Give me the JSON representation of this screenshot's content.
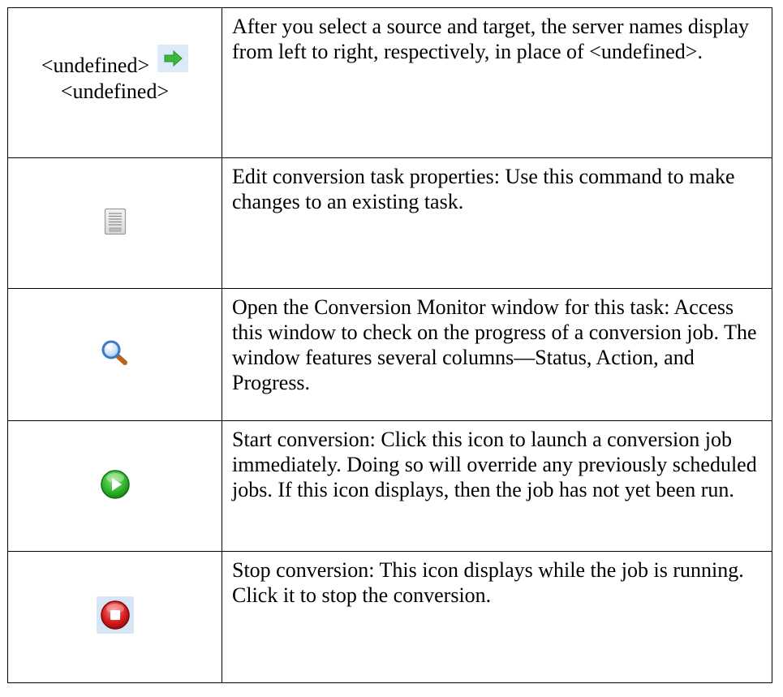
{
  "rows": [
    {
      "icon": "right-arrow-icon",
      "source_label": "<undefined>",
      "target_label": "<undefined>",
      "description": "After you select a source and target, the server names display from left to right, respectively, in place of <undefined>."
    },
    {
      "icon": "document-properties-icon",
      "description": "Edit conversion task properties:  Use this command to make changes to an existing task."
    },
    {
      "icon": "magnifier-icon",
      "description": "Open the Conversion Monitor window for this task: Access this window to check on the progress of a conversion job. The window features several columns—Status, Action, and Progress."
    },
    {
      "icon": "play-icon",
      "description": "Start conversion:  Click this icon to launch a conversion job immediately. Doing so will override any previously scheduled jobs. If this icon displays, then the job has not yet been run."
    },
    {
      "icon": "stop-icon",
      "description": "Stop conversion: This icon displays while the job is running. Click it to stop the conversion."
    }
  ],
  "colors": {
    "arrow_green": "#3db83a",
    "arrow_badge_bg": "#dbe9f8",
    "play_green": "#2fb62a",
    "stop_red": "#d81e1e",
    "stop_badge_bg": "#d7e6f6",
    "magnifier_blue": "#3a78c8",
    "magnifier_handle": "#b5651d"
  }
}
